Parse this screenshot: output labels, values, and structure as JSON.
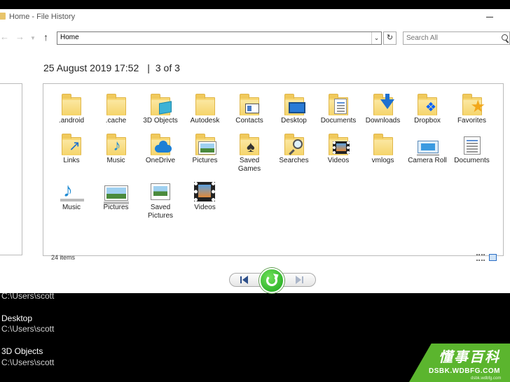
{
  "window": {
    "title": "Home - File History"
  },
  "address_bar": {
    "path": "Home",
    "search_placeholder": "Search All"
  },
  "snapshot": {
    "date": "25 August 2019 17:52",
    "separator": "|",
    "position": "3 of 3"
  },
  "items": [
    {
      "label": ".android",
      "icon": "folder-icon"
    },
    {
      "label": ".cache",
      "icon": "folder-icon"
    },
    {
      "label": "3D Objects",
      "icon": "3d-objects-folder-icon"
    },
    {
      "label": "Autodesk",
      "icon": "folder-icon"
    },
    {
      "label": "Contacts",
      "icon": "contacts-folder-icon"
    },
    {
      "label": "Desktop",
      "icon": "desktop-folder-icon"
    },
    {
      "label": "Documents",
      "icon": "documents-folder-icon"
    },
    {
      "label": "Downloads",
      "icon": "downloads-folder-icon"
    },
    {
      "label": "Dropbox",
      "icon": "dropbox-folder-icon"
    },
    {
      "label": "Favorites",
      "icon": "favorites-folder-icon"
    },
    {
      "label": "Links",
      "icon": "links-folder-icon"
    },
    {
      "label": "Music",
      "icon": "music-folder-icon"
    },
    {
      "label": "OneDrive",
      "icon": "onedrive-folder-icon"
    },
    {
      "label": "Pictures",
      "icon": "pictures-folder-icon"
    },
    {
      "label": "Saved Games",
      "icon": "saved-games-folder-icon"
    },
    {
      "label": "Searches",
      "icon": "searches-folder-icon"
    },
    {
      "label": "Videos",
      "icon": "videos-folder-icon"
    },
    {
      "label": "vmlogs",
      "icon": "folder-icon"
    },
    {
      "label": "Camera Roll",
      "icon": "camera-roll-icon"
    },
    {
      "label": "Documents",
      "icon": "documents-library-icon"
    },
    {
      "label": "Music",
      "icon": "music-library-icon"
    },
    {
      "label": "Pictures",
      "icon": "pictures-library-icon"
    },
    {
      "label": "Saved Pictures",
      "icon": "saved-pictures-icon"
    },
    {
      "label": "Videos",
      "icon": "videos-library-icon"
    }
  ],
  "status": {
    "item_count": "24 items"
  },
  "shortcuts": [
    {
      "name": "",
      "path": "C:\\Users\\scott"
    },
    {
      "name": "Desktop",
      "path": "C:\\Users\\scott"
    },
    {
      "name": "3D Objects",
      "path": "C:\\Users\\scott"
    }
  ],
  "watermark": {
    "logo": "懂事百科",
    "url": "DSBK.WDBFG.COM",
    "sub": "dsbk.wdbfg.com"
  },
  "colors": {
    "folder": "#f7d774",
    "restore_green": "#1aa51a",
    "watermark_green": "#5bb52e"
  }
}
